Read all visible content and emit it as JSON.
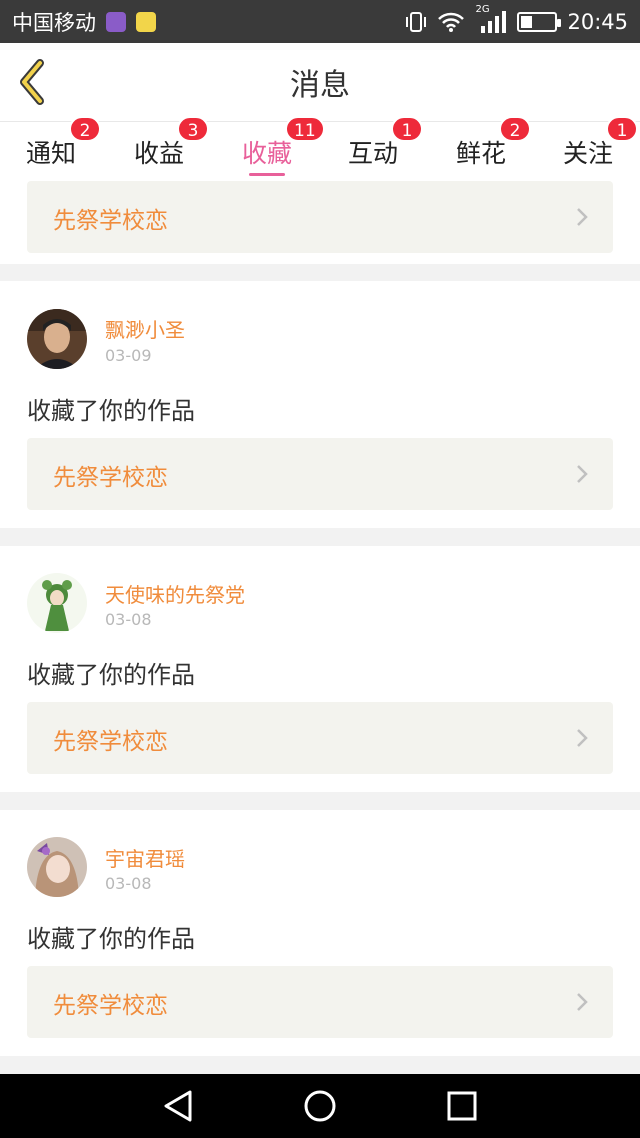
{
  "status_bar": {
    "carrier": "中国移动",
    "network": "2G",
    "battery_level": 0.35,
    "time": "20:45"
  },
  "header": {
    "title": "消息"
  },
  "tabs": [
    {
      "label": "通知",
      "badge": "2"
    },
    {
      "label": "收益",
      "badge": "3"
    },
    {
      "label": "收藏",
      "badge": "11",
      "active": true
    },
    {
      "label": "互动",
      "badge": "1"
    },
    {
      "label": "鲜花",
      "badge": "2"
    },
    {
      "label": "关注",
      "badge": "1"
    }
  ],
  "partial_item": {
    "work_title": "先祭学校恋"
  },
  "items": [
    {
      "username": "飘渺小圣",
      "date": "03-09",
      "action": "收藏了你的作品",
      "work_title": "先祭学校恋"
    },
    {
      "username": "天使味的先祭党",
      "date": "03-08",
      "action": "收藏了你的作品",
      "work_title": "先祭学校恋"
    },
    {
      "username": "宇宙君瑶",
      "date": "03-08",
      "action": "收藏了你的作品",
      "work_title": "先祭学校恋"
    }
  ],
  "colors": {
    "accent": "#e8609a",
    "name": "#f08c3c",
    "badge": "#ee2a3a"
  }
}
